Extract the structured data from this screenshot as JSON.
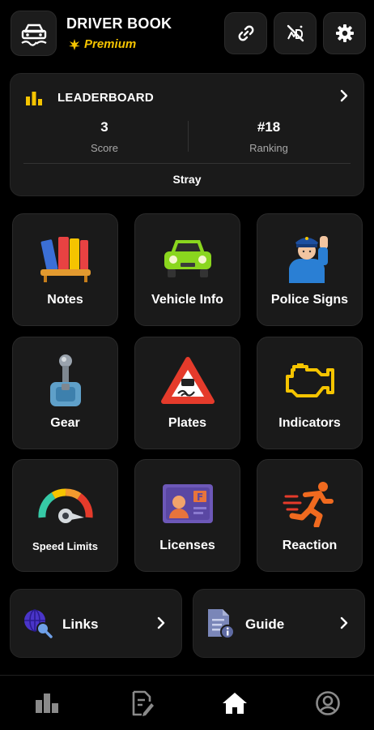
{
  "header": {
    "title": "DRIVER BOOK",
    "badge": "Premium",
    "buttons": [
      "link-icon",
      "no-ads-icon",
      "settings-icon"
    ]
  },
  "leaderboard": {
    "title": "LEADERBOARD",
    "score_value": "3",
    "score_label": "Score",
    "ranking_value": "#18",
    "ranking_label": "Ranking",
    "username": "Stray"
  },
  "tiles": [
    {
      "label": "Notes",
      "icon": "books-icon"
    },
    {
      "label": "Vehicle Info",
      "icon": "car-icon"
    },
    {
      "label": "Police Signs",
      "icon": "police-officer-icon"
    },
    {
      "label": "Gear",
      "icon": "gear-stick-icon"
    },
    {
      "label": "Plates",
      "icon": "slippery-road-sign-icon"
    },
    {
      "label": "Indicators",
      "icon": "engine-check-icon"
    },
    {
      "label": "Speed Limits",
      "icon": "speedometer-icon"
    },
    {
      "label": "Licenses",
      "icon": "license-card-icon"
    },
    {
      "label": "Reaction",
      "icon": "running-man-icon"
    }
  ],
  "cards": [
    {
      "label": "Links",
      "icon": "globe-search-icon"
    },
    {
      "label": "Guide",
      "icon": "document-info-icon"
    }
  ],
  "nav": {
    "items": [
      "stats-icon",
      "edit-document-icon",
      "home-icon",
      "profile-icon"
    ],
    "active": "home-icon"
  },
  "colors": {
    "accent": "#f5c400",
    "background": "#000000",
    "card": "#1a1a1a"
  }
}
